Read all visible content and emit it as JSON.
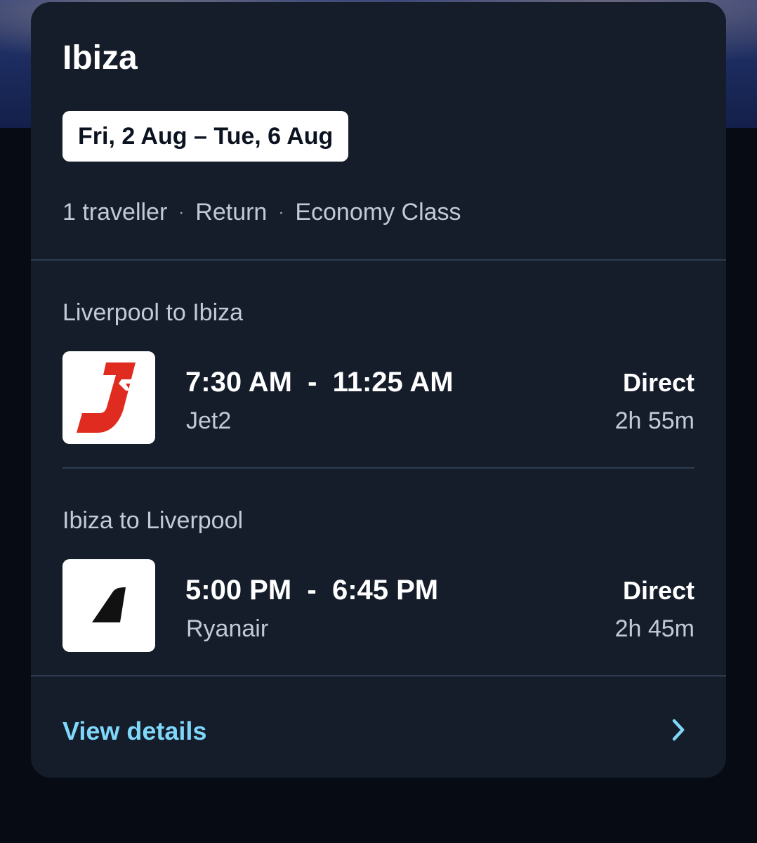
{
  "trip": {
    "destination": "Ibiza",
    "date_range": "Fri, 2 Aug – Tue, 6 Aug",
    "travellers": "1 traveller",
    "trip_type": "Return",
    "cabin_class": "Economy Class",
    "separator": "·"
  },
  "legs": [
    {
      "label": "Liverpool to Ibiza",
      "times": "7:30 AM  -  11:25 AM",
      "airline": "Jet2",
      "airline_icon": "jet2-logo-icon",
      "stops": "Direct",
      "duration": "2h 55m"
    },
    {
      "label": "Ibiza to Liverpool",
      "times": "5:00 PM  -  6:45 PM",
      "airline": "Ryanair",
      "airline_icon": "ryanair-tail-icon",
      "stops": "Direct",
      "duration": "2h 45m"
    }
  ],
  "footer": {
    "view_details_label": "View details",
    "chevron_icon": "chevron-right-icon"
  },
  "colors": {
    "card_background": "#151d2b",
    "page_background": "#070b13",
    "accent_link": "#7fd8fa",
    "secondary_text": "#c3cad6",
    "divider": "#2e3b4f",
    "jet2_red": "#e02b20"
  }
}
